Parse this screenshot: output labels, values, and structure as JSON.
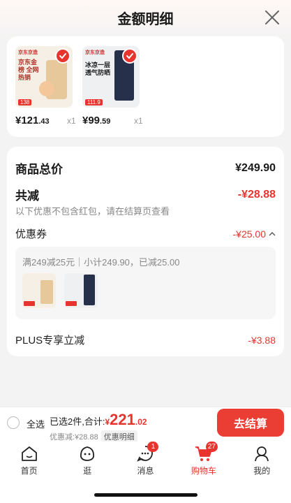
{
  "header": {
    "title": "金额明细"
  },
  "products": [
    {
      "thumb_text": "京东金榜 全网热销",
      "brand": "京东京造",
      "tag": "138",
      "price_int": "¥121",
      "price_dec": ".43",
      "qty": "x1"
    },
    {
      "thumb_text": "冰凉一层 透气防晒",
      "brand": "京东京造",
      "tag": "111.9",
      "price_int": "¥99",
      "price_dec": ".59",
      "qty": "x1"
    }
  ],
  "summary": {
    "total_label": "商品总价",
    "total_value": "¥249.90",
    "reduce_label": "共减",
    "reduce_value": "-¥28.88",
    "reduce_note": "以下优惠不包含红包，请在结算页查看",
    "coupon_label": "优惠券",
    "coupon_value": "-¥25.00",
    "coupon_desc": "满249减25元｜小计249.90，已减25.00",
    "plus_label": "PLUS专享立减",
    "plus_value": "-¥3.88"
  },
  "bottom_bar": {
    "select_all": "全选",
    "selected_info": "已选2件,合计:",
    "total_symbol": "¥",
    "total_int": "221",
    "total_dec": ".02",
    "discount_text": "优惠减:¥28.88",
    "detail_tag": "优惠明细",
    "checkout_label": "去结算"
  },
  "tabs": [
    {
      "label": "首页",
      "icon": "home-icon"
    },
    {
      "label": "逛",
      "icon": "browse-icon"
    },
    {
      "label": "消息",
      "icon": "message-icon",
      "badge": "1"
    },
    {
      "label": "购物车",
      "icon": "cart-icon",
      "badge": "27",
      "active": true
    },
    {
      "label": "我的",
      "icon": "profile-icon"
    }
  ],
  "colors": {
    "accent": "#e8342f",
    "checkout": "#ea3e35"
  }
}
